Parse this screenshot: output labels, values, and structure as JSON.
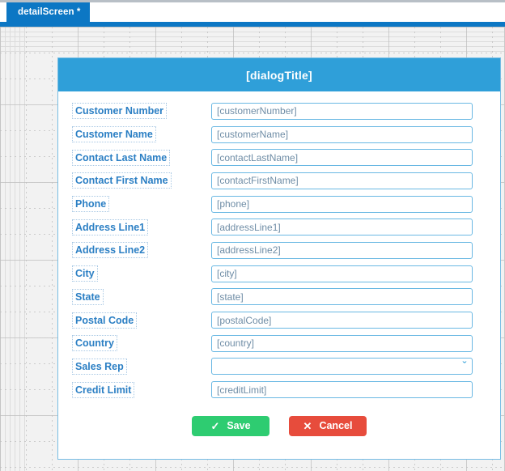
{
  "workspace": {
    "tab": {
      "label": "detailScreen *",
      "modified_marker": "*"
    }
  },
  "dialog": {
    "title": "[dialogTitle]",
    "fields": [
      {
        "label": "Customer Number",
        "type": "text",
        "placeholder": "[customerNumber]"
      },
      {
        "label": "Customer Name",
        "type": "text",
        "placeholder": "[customerName]"
      },
      {
        "label": "Contact Last Name",
        "type": "text",
        "placeholder": "[contactLastName]"
      },
      {
        "label": "Contact First Name",
        "type": "text",
        "placeholder": "[contactFirstName]"
      },
      {
        "label": "Phone",
        "type": "text",
        "placeholder": "[phone]"
      },
      {
        "label": "Address Line1",
        "type": "text",
        "placeholder": "[addressLine1]"
      },
      {
        "label": "Address Line2",
        "type": "text",
        "placeholder": "[addressLine2]"
      },
      {
        "label": "City",
        "type": "text",
        "placeholder": "[city]"
      },
      {
        "label": "State",
        "type": "text",
        "placeholder": "[state]"
      },
      {
        "label": "Postal Code",
        "type": "text",
        "placeholder": "[postalCode]"
      },
      {
        "label": "Country",
        "type": "text",
        "placeholder": "[country]"
      },
      {
        "label": "Sales Rep",
        "type": "select",
        "placeholder": "",
        "selected": ""
      },
      {
        "label": "Credit Limit",
        "type": "text",
        "placeholder": "[creditLimit]"
      }
    ],
    "buttons": {
      "save": {
        "label": "Save",
        "icon": "check-icon",
        "glyph": "✓"
      },
      "cancel": {
        "label": "Cancel",
        "icon": "close-icon",
        "glyph": "✕"
      }
    },
    "select_chevron": {
      "icon": "chevron-down-icon",
      "glyph": "ˇ"
    }
  },
  "colors": {
    "tab_blue": "#0c77c4",
    "dialog_header_blue": "#2f9fd9",
    "dialog_border": "#77bde4",
    "label_text": "#2b7fc4",
    "input_border": "#6ab8e3",
    "placeholder_text": "#6f8da6",
    "save_green": "#2ecc71",
    "cancel_red": "#e74c3c",
    "canvas_bg": "#f2f2f2"
  }
}
